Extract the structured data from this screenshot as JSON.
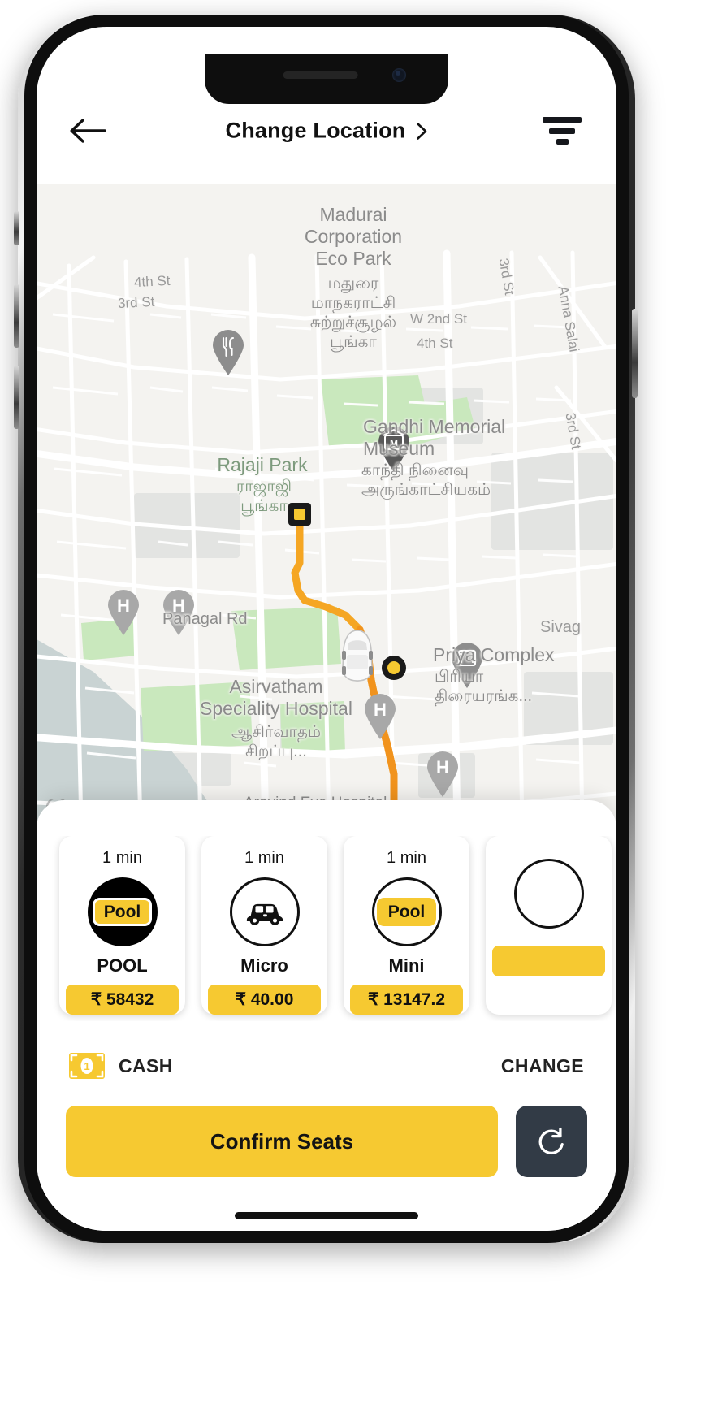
{
  "header": {
    "back_icon": "back-arrow-icon",
    "title": "Change Location",
    "chevron_icon": "chevron-right-icon",
    "filter_icon": "filter-lines-icon"
  },
  "map": {
    "places": [
      {
        "name": "Madurai\nCorporation\nEco Park",
        "tamil": "மதுரை\nமாநகராட்சி\nசுற்றுச்சூழல்\nபூங்கா"
      },
      {
        "name": "Gandhi Memorial\nMuseum",
        "tamil": "காந்தி நினைவு\nஅருங்காட்சியகம்"
      },
      {
        "name": "Rajaji Park",
        "tamil": "ராஜாஜி\nபூங்கா"
      },
      {
        "name": "Asirvatham\nSpeciality Hospital",
        "tamil": "ஆசிர்வாதம்\nசிறப்பு..."
      },
      {
        "name": "Priya Complex",
        "tamil": "பிரியா\nதிரையரங்க..."
      },
      {
        "name": "Aravind Eye Hospital",
        "tamil": ""
      }
    ],
    "streets": [
      "4th St",
      "3rd St",
      "W 2nd St",
      "4th St",
      "3rd St",
      "Anna Salai",
      "3rd St",
      "Panagal Rd",
      "Sivag"
    ],
    "markers": [
      {
        "type": "restaurant-pin",
        "label": "restaurant"
      },
      {
        "type": "museum-pin",
        "label": "museum"
      },
      {
        "type": "hospital-pin",
        "label": "H"
      },
      {
        "type": "hospital-pin",
        "label": "H"
      },
      {
        "type": "hospital-pin",
        "label": "H"
      },
      {
        "type": "hospital-pin",
        "label": "H"
      },
      {
        "type": "theater-pin",
        "label": "theater"
      }
    ],
    "route_color": "#f5a623",
    "origin_marker": "square-origin-marker",
    "destination_marker": "circle-destination-marker",
    "vehicle_marker": "car-top-view-icon"
  },
  "sheet": {
    "ride_options": [
      {
        "eta": "1 min",
        "name": "POOL",
        "price": "₹ 58432",
        "badge": "Pool",
        "icon": "pool-badge-icon",
        "selected": true
      },
      {
        "eta": "1 min",
        "name": "Micro",
        "price": "₹ 40.00",
        "badge": "",
        "icon": "car-icon",
        "selected": false
      },
      {
        "eta": "1 min",
        "name": "Mini",
        "price": "₹ 13147.2",
        "badge": "Pool",
        "icon": "pool-badge-icon",
        "selected": false
      },
      {
        "eta": "",
        "name": "",
        "price": "",
        "badge": "",
        "icon": "",
        "selected": false
      }
    ],
    "payment": {
      "icon": "cash-note-icon",
      "method": "CASH",
      "change_label": "CHANGE"
    },
    "confirm_label": "Confirm Seats",
    "refresh_icon": "refresh-icon"
  },
  "colors": {
    "accent": "#f6c931",
    "route": "#f5a623",
    "dark": "#323b46",
    "text": "#111111"
  }
}
